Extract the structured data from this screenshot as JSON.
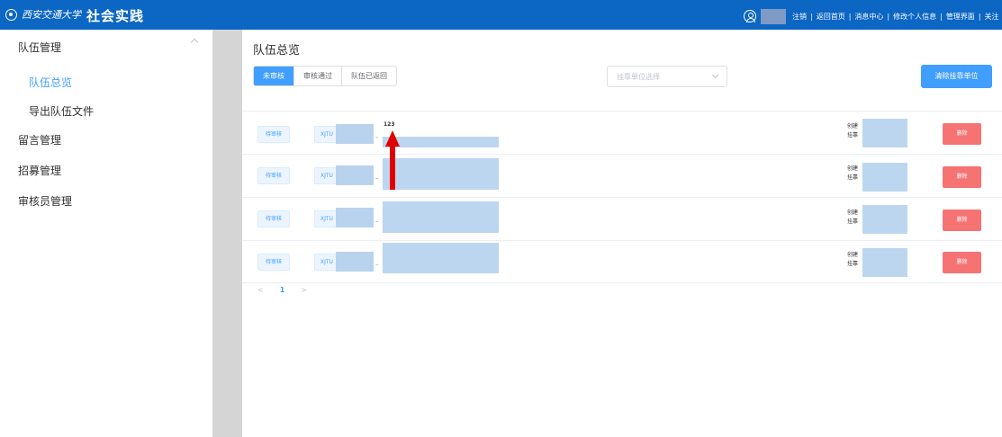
{
  "header": {
    "logo_text": "西安交通大学",
    "app_title": "社会实践",
    "links": [
      "注销",
      "返回首页",
      "消息中心",
      "修改个人信息",
      "管理界面",
      "关注"
    ]
  },
  "sidebar": {
    "groups": [
      {
        "label": "队伍管理",
        "expanded": true,
        "items": [
          {
            "label": "队伍总览",
            "active": true
          },
          {
            "label": "导出队伍文件",
            "active": false
          }
        ]
      },
      {
        "label": "留言管理"
      },
      {
        "label": "招募管理"
      },
      {
        "label": "审核员管理"
      }
    ]
  },
  "main": {
    "title": "队伍总览",
    "tabs": [
      {
        "label": "未审核",
        "active": true
      },
      {
        "label": "审核通过",
        "active": false
      },
      {
        "label": "队伍已返回",
        "active": false
      }
    ],
    "select_placeholder": "挂靠单位选择",
    "clear_button": "清除挂靠单位",
    "rows": [
      {
        "status": "待审核",
        "team_id_prefix": "XJTU",
        "name": "123",
        "meta": [
          "创建",
          "挂靠"
        ],
        "delete": "删除"
      },
      {
        "status": "待审核",
        "team_id_prefix": "XJTU",
        "name": "",
        "meta": [
          "创建",
          "挂靠"
        ],
        "delete": "删除"
      },
      {
        "status": "待审核",
        "team_id_prefix": "XJTU",
        "name": "",
        "meta": [
          "创建",
          "挂靠"
        ],
        "delete": "删除"
      },
      {
        "status": "待审核",
        "team_id_prefix": "XJTU",
        "name": "",
        "meta": [
          "创建",
          "挂靠"
        ],
        "delete": "删除"
      }
    ],
    "pagination": {
      "prev": "<",
      "current": "1",
      "next": ">"
    }
  },
  "colors": {
    "header": "#0c66c4",
    "primary": "#409eff",
    "danger": "#f56c6c",
    "mask": "#bcd6ef",
    "annotation_arrow": "#e00000"
  }
}
